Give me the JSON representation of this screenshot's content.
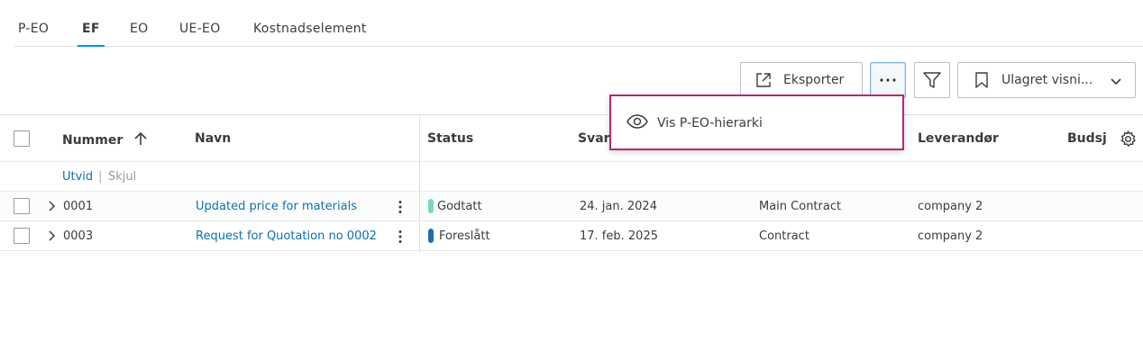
{
  "tabs": [
    {
      "label": "P-EO",
      "active": false
    },
    {
      "label": "EF",
      "active": true
    },
    {
      "label": "EO",
      "active": false
    },
    {
      "label": "UE-EO",
      "active": false
    },
    {
      "label": "Kostnadselement",
      "active": false
    }
  ],
  "toolbar": {
    "export_label": "Eksporter",
    "view_label": "Ulagret visni..."
  },
  "dropdown": {
    "item_label": "Vis P-EO-hierarki"
  },
  "table": {
    "headers": {
      "nummer": "Nummer",
      "navn": "Navn",
      "status": "Status",
      "svar": "Svar",
      "leverandor": "Leverandør",
      "budsj": "Budsj"
    },
    "expand_label": "Utvid",
    "separator": "|",
    "collapse_label": "Skjul",
    "rows": [
      {
        "nummer": "0001",
        "navn": "Updated price for materials",
        "status": "Godtatt",
        "status_color": "#7fd3c9",
        "svar": "24. jan. 2024",
        "contract": "Main Contract",
        "leverandor": "company 2"
      },
      {
        "nummer": "0003",
        "navn": "Request for Quotation no 0002",
        "status": "Foreslått",
        "status_color": "#1b6fa8",
        "svar": "17. feb. 2025",
        "contract": "Contract",
        "leverandor": "company 2"
      }
    ]
  },
  "colors": {
    "accent": "#0696d7",
    "link": "#0e6fb0",
    "highlight_border": "#b5277a"
  }
}
